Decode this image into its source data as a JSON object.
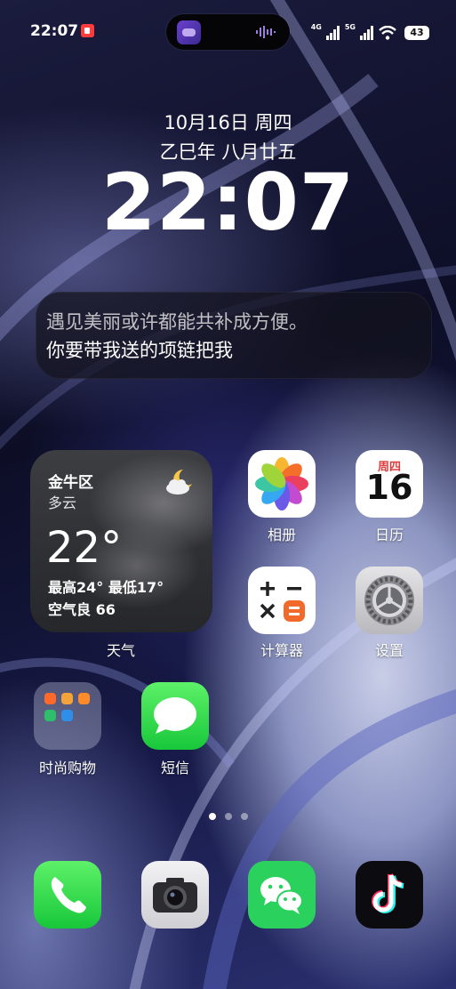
{
  "status_bar": {
    "time": "22:07",
    "net1": "4G",
    "net2": "5G",
    "battery": "43",
    "colors": {
      "record": "#ff3b3b"
    }
  },
  "lock": {
    "date": "10月16日 周四",
    "lunar": "乙巳年 八月廿五",
    "clock": "22:07"
  },
  "quote": {
    "line1": "遇见美丽或许都能共补成方便。",
    "line2": "你要带我送的项链把我"
  },
  "weather": {
    "city": "金牛区",
    "condition": "多云",
    "temperature": "22°",
    "range": "最高24° 最低17°",
    "air": "空气良 66",
    "label": "天气"
  },
  "apps": {
    "photos": "相册",
    "calendar": "日历",
    "calendar_weekday": "周四",
    "calendar_day": "16",
    "calculator": "计算器",
    "settings": "设置",
    "folder": "时尚购物",
    "messages": "短信"
  },
  "pager": {
    "pages": 3,
    "current": 1
  },
  "dock": {
    "icons": [
      "phone-icon",
      "camera-icon",
      "wechat-icon",
      "tiktok-icon"
    ]
  }
}
